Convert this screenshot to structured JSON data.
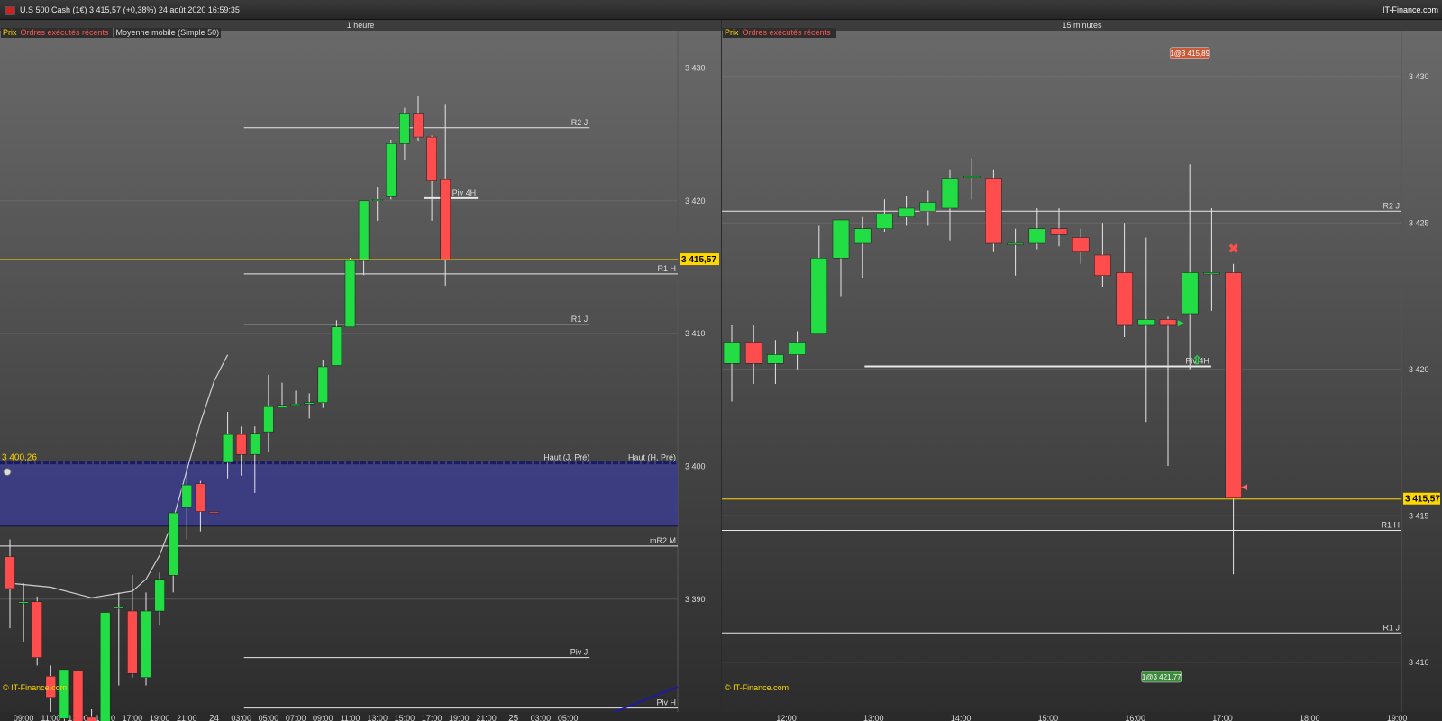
{
  "header": {
    "instrument": "U.S 500 Cash (1€)   3 415,57 (+0,38%)   24 août 2020 16:59:35",
    "brand": "IT-Finance.com",
    "flag_color": "#cc2222"
  },
  "colors": {
    "up": "#22dd44",
    "down": "#ff4d4d",
    "price_line": "#ffd700",
    "band": "#3c3c8c",
    "ma": "#cfcfcf"
  },
  "legend": {
    "prix": "Prix",
    "orders": "Ordres exécutés récents",
    "ma": "Moyenne mobile (Simple 50)"
  },
  "copyright": "© IT-Finance.com",
  "chart_data": [
    {
      "type": "candlestick",
      "title": "1 heure",
      "ylim": [
        3381.5,
        3432
      ],
      "yticks": [
        3390,
        3400,
        3410,
        3420,
        3430
      ],
      "ytick_labels": [
        "3 390",
        "3 400",
        "3 410",
        "3 420",
        "3 430"
      ],
      "x_labels": [
        {
          "i": 1,
          "t": "09:00"
        },
        {
          "i": 3,
          "t": "11:00"
        },
        {
          "i": 5,
          "t": "13:00"
        },
        {
          "i": 7,
          "t": "15:00"
        },
        {
          "i": 9,
          "t": "17:00"
        },
        {
          "i": 11,
          "t": "19:00"
        },
        {
          "i": 13,
          "t": "21:00"
        },
        {
          "i": 15,
          "t": "24",
          "major": true
        },
        {
          "i": 17,
          "t": "03:00"
        },
        {
          "i": 19,
          "t": "05:00"
        },
        {
          "i": 21,
          "t": "07:00"
        },
        {
          "i": 23,
          "t": "09:00"
        },
        {
          "i": 25,
          "t": "11:00"
        },
        {
          "i": 27,
          "t": "13:00"
        },
        {
          "i": 29,
          "t": "15:00"
        },
        {
          "i": 31,
          "t": "17:00"
        },
        {
          "i": 33,
          "t": "19:00"
        },
        {
          "i": 35,
          "t": "21:00"
        },
        {
          "i": 37,
          "t": "25",
          "major": true
        },
        {
          "i": 39,
          "t": "03:00"
        },
        {
          "i": 41,
          "t": "05:00"
        }
      ],
      "candles": [
        {
          "o": 3393.2,
          "h": 3394.5,
          "l": 3387.8,
          "c": 3390.8
        },
        {
          "o": 3389.8,
          "h": 3391.2,
          "l": 3386.8,
          "c": 3389.8
        },
        {
          "o": 3389.8,
          "h": 3390.2,
          "l": 3385.0,
          "c": 3385.6
        },
        {
          "o": 3384.2,
          "h": 3385.0,
          "l": 3381.5,
          "c": 3382.6
        },
        {
          "o": 3381.0,
          "h": 3383.3,
          "l": 3379.3,
          "c": 3384.7
        },
        {
          "o": 3384.6,
          "h": 3385.3,
          "l": 3379.6,
          "c": 3380.6
        },
        {
          "o": 3381.1,
          "h": 3381.7,
          "l": 3379.3,
          "c": 3380.4
        },
        {
          "o": 3380.0,
          "h": 3389.0,
          "l": 3379.0,
          "c": 3389.0
        },
        {
          "o": 3389.4,
          "h": 3390.5,
          "l": 3383.5,
          "c": 3389.4
        },
        {
          "o": 3389.1,
          "h": 3391.8,
          "l": 3384.1,
          "c": 3384.4
        },
        {
          "o": 3384.1,
          "h": 3390.5,
          "l": 3383.5,
          "c": 3389.1
        },
        {
          "o": 3389.1,
          "h": 3392.0,
          "l": 3388.0,
          "c": 3391.5
        },
        {
          "o": 3391.8,
          "h": 3396.5,
          "l": 3390.5,
          "c": 3396.5
        },
        {
          "o": 3396.9,
          "h": 3400.0,
          "l": 3394.5,
          "c": 3398.6
        },
        {
          "o": 3398.7,
          "h": 3398.9,
          "l": 3395.1,
          "c": 3396.6
        },
        {
          "o": 3396.6,
          "h": 3396.6,
          "l": 3396.4,
          "c": 3396.5
        },
        {
          "o": 3400.3,
          "h": 3404.1,
          "l": 3399.1,
          "c": 3402.4
        },
        {
          "o": 3402.4,
          "h": 3403.0,
          "l": 3399.3,
          "c": 3400.9
        },
        {
          "o": 3400.9,
          "h": 3403.0,
          "l": 3398.0,
          "c": 3402.5
        },
        {
          "o": 3402.6,
          "h": 3406.9,
          "l": 3401.1,
          "c": 3404.5
        },
        {
          "o": 3404.4,
          "h": 3406.3,
          "l": 3404.4,
          "c": 3404.6
        },
        {
          "o": 3404.6,
          "h": 3405.7,
          "l": 3404.6,
          "c": 3404.7
        },
        {
          "o": 3404.7,
          "h": 3405.5,
          "l": 3403.6,
          "c": 3404.8
        },
        {
          "o": 3404.8,
          "h": 3408.0,
          "l": 3404.4,
          "c": 3407.5
        },
        {
          "o": 3407.6,
          "h": 3411.0,
          "l": 3407.6,
          "c": 3410.5
        },
        {
          "o": 3410.5,
          "h": 3415.7,
          "l": 3410.5,
          "c": 3415.5
        },
        {
          "o": 3415.5,
          "h": 3420.0,
          "l": 3414.4,
          "c": 3420.0
        },
        {
          "o": 3420.0,
          "h": 3421.0,
          "l": 3418.5,
          "c": 3420.1
        },
        {
          "o": 3420.3,
          "h": 3424.6,
          "l": 3420.1,
          "c": 3424.3
        },
        {
          "o": 3424.3,
          "h": 3427.0,
          "l": 3423.1,
          "c": 3426.6
        },
        {
          "o": 3426.6,
          "h": 3427.9,
          "l": 3424.5,
          "c": 3424.8
        },
        {
          "o": 3424.8,
          "h": 3424.9,
          "l": 3418.5,
          "c": 3421.5
        },
        {
          "o": 3421.6,
          "h": 3427.3,
          "l": 3413.6,
          "c": 3415.6
        }
      ],
      "ma50": [
        [
          0,
          3391.2
        ],
        [
          3,
          3390.9
        ],
        [
          6,
          3390.1
        ],
        [
          9,
          3390.6
        ],
        [
          10,
          3391.5
        ],
        [
          11,
          3393.3
        ],
        [
          12,
          3396.0
        ],
        [
          13,
          3399.7
        ],
        [
          14,
          3403.3
        ],
        [
          15,
          3406.4
        ],
        [
          16,
          3408.4
        ]
      ],
      "current_price": 3415.57,
      "current_price_label": "3 415,57",
      "band": {
        "top": 3400.26,
        "bottom": 3395.5,
        "label": "3 400,26",
        "label_left": "Haut (J, Pré)",
        "label_right": "Haut (H, Pré)"
      },
      "levels": [
        {
          "label": "R2 J",
          "value": 3425.5,
          "x0": 0.36,
          "x1": 0.87
        },
        {
          "label": "R1 H",
          "value": 3414.5,
          "x0": 0.36,
          "x1": 1.0
        },
        {
          "label": "R1 J",
          "value": 3410.7,
          "x0": 0.36,
          "x1": 0.87
        },
        {
          "label": "mR2 M",
          "value": 3394.0,
          "x0": 0,
          "x1": 1.0
        },
        {
          "label": "Piv J",
          "value": 3385.6,
          "x0": 0.36,
          "x1": 0.87
        },
        {
          "label": "Piv H",
          "value": 3381.8,
          "x0": 0.36,
          "x1": 1.0
        },
        {
          "label": "Piv 4H",
          "value": 3420.2,
          "x0": 0.625,
          "x1": 0.705
        }
      ]
    },
    {
      "type": "candlestick",
      "title": "15 minutes",
      "ylim": [
        3408.3,
        3431.5
      ],
      "yticks": [
        3410,
        3415,
        3420,
        3425,
        3430
      ],
      "ytick_labels": [
        "3 410",
        "3 415",
        "3 420",
        "3 425",
        "3 430"
      ],
      "x_labels": [
        {
          "i": 2.5,
          "t": "12:00"
        },
        {
          "i": 6.5,
          "t": "13:00"
        },
        {
          "i": 10.5,
          "t": "14:00"
        },
        {
          "i": 14.5,
          "t": "15:00"
        },
        {
          "i": 18.5,
          "t": "16:00"
        },
        {
          "i": 22.5,
          "t": "17:00"
        },
        {
          "i": 26.5,
          "t": "18:00"
        },
        {
          "i": 30.5,
          "t": "19:00"
        }
      ],
      "candles": [
        {
          "o": 3420.2,
          "h": 3421.5,
          "l": 3418.9,
          "c": 3420.9
        },
        {
          "o": 3420.9,
          "h": 3421.5,
          "l": 3419.5,
          "c": 3420.2
        },
        {
          "o": 3420.2,
          "h": 3421.0,
          "l": 3419.5,
          "c": 3420.5
        },
        {
          "o": 3420.5,
          "h": 3421.3,
          "l": 3420.0,
          "c": 3420.9
        },
        {
          "o": 3421.2,
          "h": 3424.9,
          "l": 3421.2,
          "c": 3423.8
        },
        {
          "o": 3423.8,
          "h": 3425.1,
          "l": 3422.5,
          "c": 3425.1
        },
        {
          "o": 3424.3,
          "h": 3425.2,
          "l": 3423.1,
          "c": 3424.8
        },
        {
          "o": 3424.8,
          "h": 3425.8,
          "l": 3424.7,
          "c": 3425.3
        },
        {
          "o": 3425.2,
          "h": 3425.9,
          "l": 3424.9,
          "c": 3425.5
        },
        {
          "o": 3425.4,
          "h": 3426.1,
          "l": 3424.9,
          "c": 3425.7
        },
        {
          "o": 3425.5,
          "h": 3426.8,
          "l": 3424.4,
          "c": 3426.5
        },
        {
          "o": 3426.6,
          "h": 3427.2,
          "l": 3425.8,
          "c": 3426.6
        },
        {
          "o": 3426.5,
          "h": 3426.8,
          "l": 3424.0,
          "c": 3424.3
        },
        {
          "o": 3424.3,
          "h": 3424.8,
          "l": 3423.2,
          "c": 3424.3
        },
        {
          "o": 3424.3,
          "h": 3425.5,
          "l": 3424.1,
          "c": 3424.8
        },
        {
          "o": 3424.8,
          "h": 3425.5,
          "l": 3424.2,
          "c": 3424.6
        },
        {
          "o": 3424.5,
          "h": 3424.8,
          "l": 3423.6,
          "c": 3424.0
        },
        {
          "o": 3423.9,
          "h": 3425.0,
          "l": 3422.8,
          "c": 3423.2
        },
        {
          "o": 3423.3,
          "h": 3425.0,
          "l": 3421.1,
          "c": 3421.5
        },
        {
          "o": 3421.5,
          "h": 3424.5,
          "l": 3418.2,
          "c": 3421.7
        },
        {
          "o": 3421.7,
          "h": 3421.8,
          "l": 3416.7,
          "c": 3421.5
        },
        {
          "o": 3421.9,
          "h": 3427.0,
          "l": 3420.0,
          "c": 3423.3
        },
        {
          "o": 3423.3,
          "h": 3425.5,
          "l": 3422.0,
          "c": 3423.3
        },
        {
          "o": 3423.3,
          "h": 3423.6,
          "l": 3413.0,
          "c": 3415.6
        }
      ],
      "current_price": 3415.57,
      "current_price_label": "3 415,57",
      "levels": [
        {
          "label": "R2 J",
          "value": 3425.4,
          "x0": 0,
          "x1": 1.0
        },
        {
          "label": "R1 H",
          "value": 3414.5,
          "x0": 0,
          "x1": 1.0
        },
        {
          "label": "R1 J",
          "value": 3411.0,
          "x0": 0,
          "x1": 1.0
        },
        {
          "label": "Piv 4H",
          "value": 3420.1,
          "x0": 0.21,
          "x1": 0.72
        }
      ],
      "orders": [
        {
          "label": "1@3 415,89",
          "price": 3430.8,
          "index": 21,
          "color": "#c85a3a"
        },
        {
          "label": "1@3 421,77",
          "price": 3409.5,
          "index": 19.7,
          "color": "#3d8a3d"
        }
      ]
    }
  ]
}
